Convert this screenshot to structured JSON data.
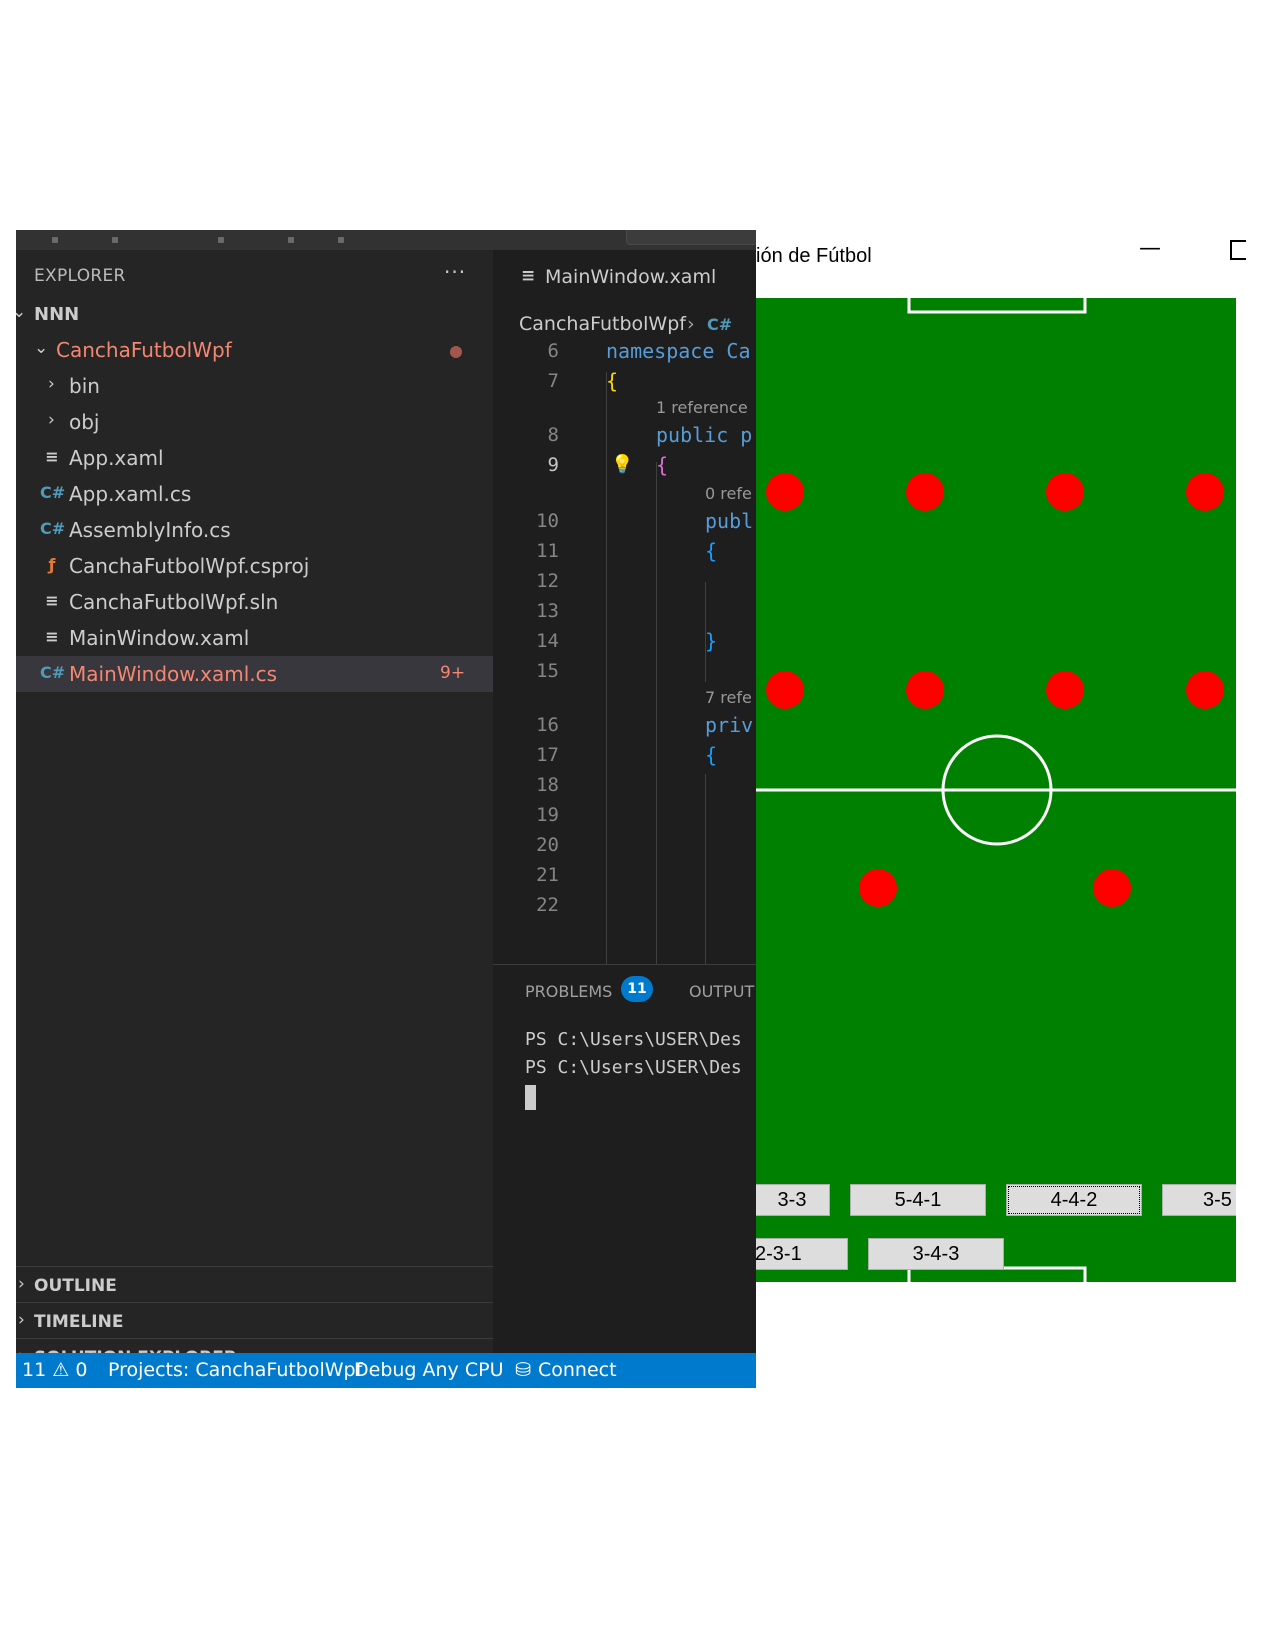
{
  "vscode": {
    "explorer": {
      "title": "EXPLORER",
      "more": "···",
      "root": "NNN",
      "project": "CanchaFutbolWpf",
      "items": [
        {
          "label": "bin",
          "kind": "folder"
        },
        {
          "label": "obj",
          "kind": "folder"
        },
        {
          "label": "App.xaml",
          "kind": "xaml"
        },
        {
          "label": "App.xaml.cs",
          "kind": "cs"
        },
        {
          "label": "AssemblyInfo.cs",
          "kind": "cs"
        },
        {
          "label": "CanchaFutbolWpf.csproj",
          "kind": "csproj"
        },
        {
          "label": "CanchaFutbolWpf.sln",
          "kind": "sln"
        },
        {
          "label": "MainWindow.xaml",
          "kind": "xaml"
        },
        {
          "label": "MainWindow.xaml.cs",
          "kind": "cs",
          "badge": "9+"
        }
      ],
      "sections": [
        "OUTLINE",
        "TIMELINE",
        "SOLUTION EXPLORER"
      ]
    },
    "editor": {
      "tab": "MainWindow.xaml",
      "breadcrumb": "CanchaFutbolWpf",
      "lines": [
        {
          "n": "6",
          "code": "namespace Ca"
        },
        {
          "n": "7",
          "code": "{"
        },
        {
          "lens": "1 reference"
        },
        {
          "n": "8",
          "code": "public p"
        },
        {
          "n": "9",
          "code": "{"
        },
        {
          "lens": "0 refe"
        },
        {
          "n": "10",
          "code": "publ"
        },
        {
          "n": "11",
          "code": "{"
        },
        {
          "n": "12",
          "code": ""
        },
        {
          "n": "13",
          "code": ""
        },
        {
          "n": "14",
          "code": "}"
        },
        {
          "n": "15",
          "code": ""
        },
        {
          "lens": "7 refe"
        },
        {
          "n": "16",
          "code": "priv"
        },
        {
          "n": "17",
          "code": "{"
        },
        {
          "n": "18",
          "code": ""
        },
        {
          "n": "19",
          "code": ""
        },
        {
          "n": "20",
          "code": ""
        },
        {
          "n": "21",
          "code": ""
        },
        {
          "n": "22",
          "code": ""
        }
      ]
    },
    "panel": {
      "problems_label": "PROBLEMS",
      "problems_count": "11",
      "output_label": "OUTPUT",
      "terminal_lines": [
        "PS C:\\Users\\USER\\Des",
        "PS C:\\Users\\USER\\Des"
      ]
    },
    "statusbar": {
      "errors": "11",
      "warnings": "0",
      "projects": "Projects: CanchaFutbolWpf",
      "config": "Debug Any CPU",
      "connect": "Connect"
    }
  },
  "wpf": {
    "title": "ión de Fútbol",
    "minimize": "—",
    "colors": {
      "field": "#008000",
      "player": "#ff0000",
      "lines": "#ffffff"
    },
    "players": [
      {
        "row": 1,
        "col": 1
      },
      {
        "row": 1,
        "col": 2
      },
      {
        "row": 1,
        "col": 3
      },
      {
        "row": 1,
        "col": 4
      },
      {
        "row": 2,
        "col": 1
      },
      {
        "row": 2,
        "col": 2
      },
      {
        "row": 2,
        "col": 3
      },
      {
        "row": 2,
        "col": 4
      },
      {
        "row": 3,
        "col": 1
      },
      {
        "row": 3,
        "col": 2
      }
    ],
    "formations_row1": [
      "3-3",
      "5-4-1",
      "4-4-2",
      "3-5"
    ],
    "formations_row2": [
      "2-3-1",
      "3-4-3"
    ],
    "selected_formation": "4-4-2"
  }
}
